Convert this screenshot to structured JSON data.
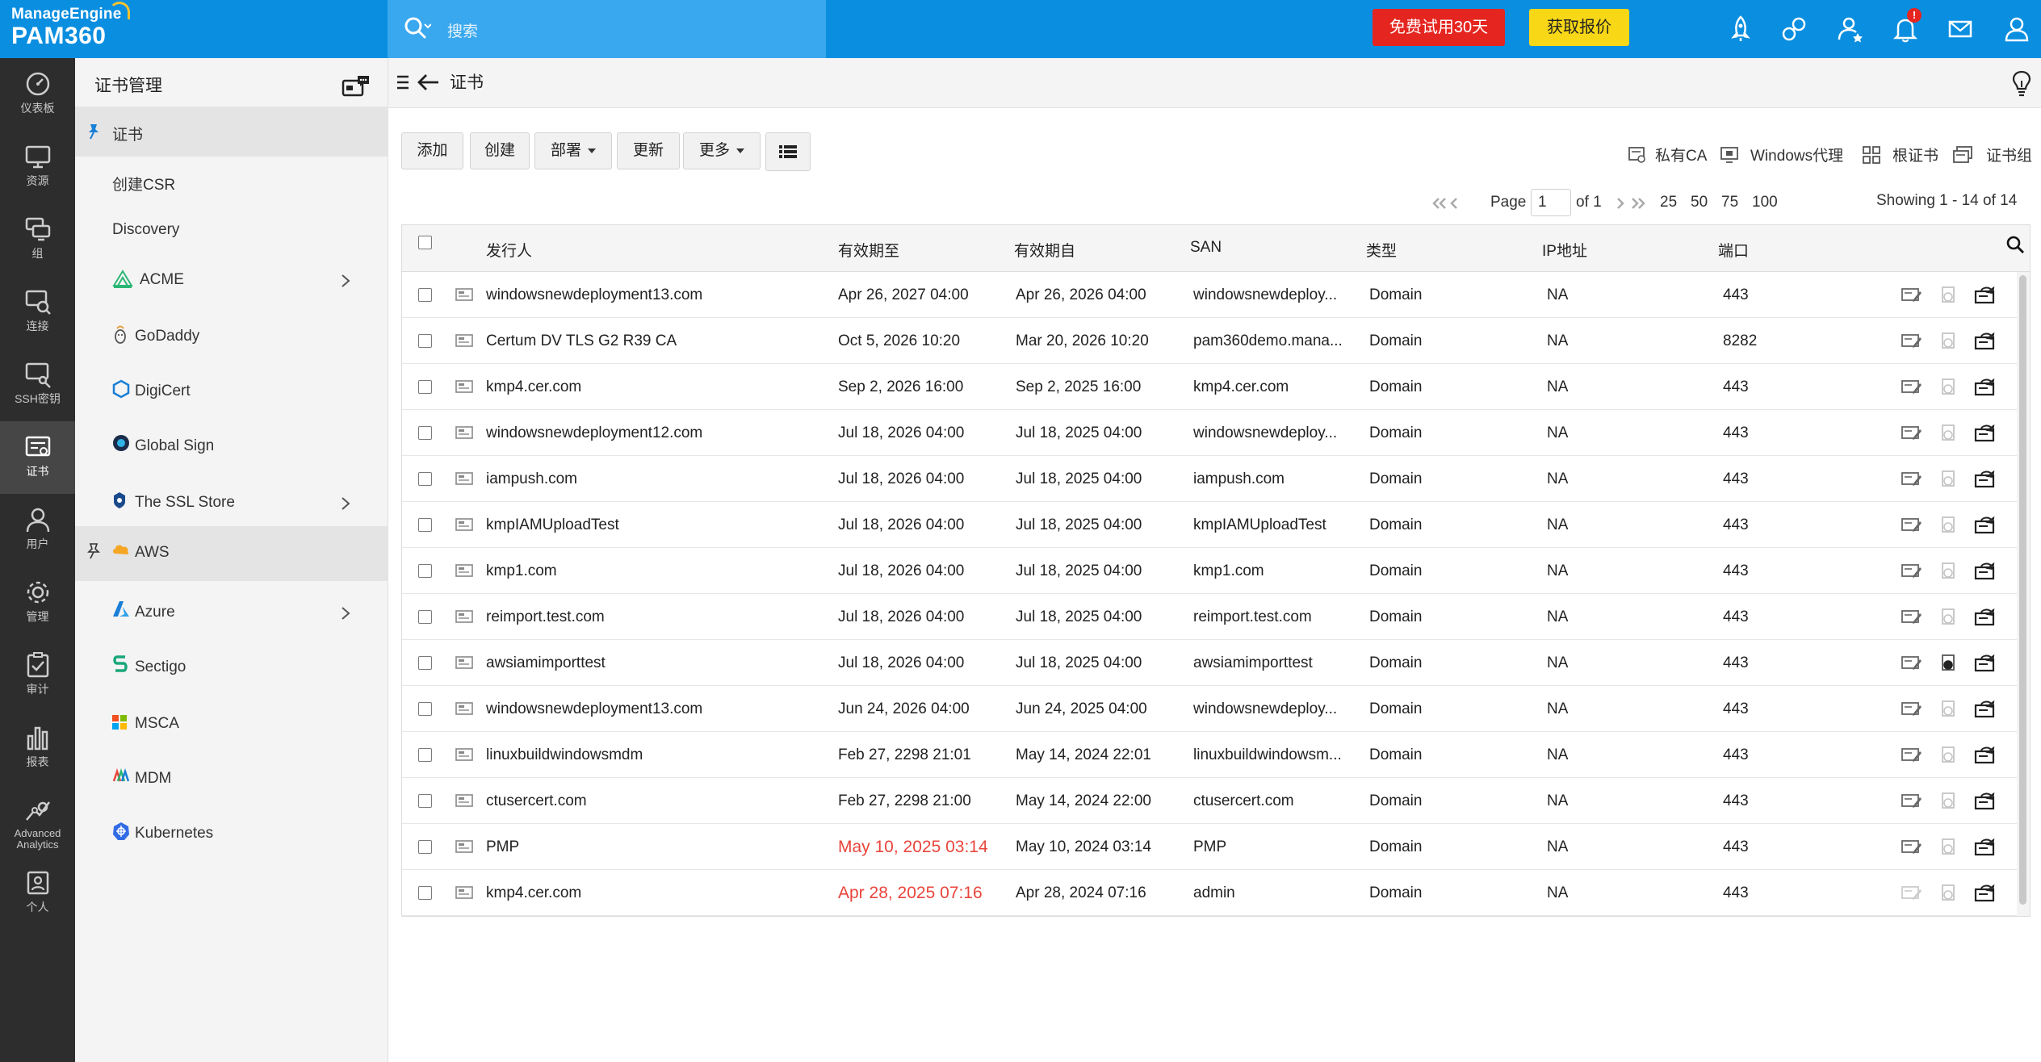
{
  "brand": {
    "company": "ManageEngine",
    "product": "PAM360"
  },
  "search": {
    "placeholder": "搜索"
  },
  "header_buttons": {
    "trial": "免费试用30天",
    "quote": "获取报价"
  },
  "top_icons": [
    "rocket-icon",
    "integration-icon",
    "user-star-icon",
    "bell-icon",
    "mail-icon",
    "user-icon"
  ],
  "notifications_badge": "!",
  "sidebar": [
    {
      "label": "仪表板",
      "icon": "dashboard-icon"
    },
    {
      "label": "资源",
      "icon": "monitor-icon"
    },
    {
      "label": "组",
      "icon": "groups-icon"
    },
    {
      "label": "连接",
      "icon": "connections-icon"
    },
    {
      "label": "SSH密钥",
      "icon": "ssh-key-icon"
    },
    {
      "label": "证书",
      "icon": "certificate-icon",
      "active": true
    },
    {
      "label": "用户",
      "icon": "user-icon"
    },
    {
      "label": "管理",
      "icon": "gear-icon"
    },
    {
      "label": "审计",
      "icon": "audit-icon"
    },
    {
      "label": "报表",
      "icon": "reports-icon"
    },
    {
      "label": "Advanced Analytics",
      "icon": "analytics-icon"
    },
    {
      "label": "个人",
      "icon": "personal-icon"
    }
  ],
  "subnav": {
    "title": "证书管理",
    "items": [
      {
        "label": "证书",
        "active": true,
        "pinned": true
      },
      {
        "label": "创建CSR"
      },
      {
        "label": "Discovery"
      },
      {
        "label": "ACME",
        "icon": "acme-icon",
        "has_children": true
      },
      {
        "label": "GoDaddy",
        "icon": "godaddy-icon"
      },
      {
        "label": "DigiCert",
        "icon": "digicert-icon"
      },
      {
        "label": "Global Sign",
        "icon": "globalsign-icon"
      },
      {
        "label": "The SSL Store",
        "icon": "sslstore-icon",
        "has_children": true
      },
      {
        "label": "AWS",
        "icon": "aws-icon",
        "hover": true
      },
      {
        "label": "Azure",
        "icon": "azure-icon",
        "has_children": true
      },
      {
        "label": "Sectigo",
        "icon": "sectigo-icon"
      },
      {
        "label": "MSCA",
        "icon": "msca-icon"
      },
      {
        "label": "MDM",
        "icon": "mdm-icon"
      },
      {
        "label": "Kubernetes",
        "icon": "kubernetes-icon"
      }
    ]
  },
  "page": {
    "title": "证书"
  },
  "toolbar": {
    "add": "添加",
    "create": "创建",
    "deploy": "部署",
    "update": "更新",
    "more": "更多",
    "right_links": [
      "私有CA",
      "Windows代理",
      "根证书",
      "证书组"
    ]
  },
  "pagination": {
    "page_label": "Page",
    "page_value": "1",
    "of_label": "of 1",
    "page_sizes": [
      "25",
      "50",
      "75",
      "100"
    ],
    "showing": "Showing 1 - 14 of 14"
  },
  "table": {
    "columns": [
      "发行人",
      "有效期至",
      "有效期自",
      "SAN",
      "类型",
      "IP地址",
      "端口"
    ],
    "rows": [
      {
        "issuer": "windowsnewdeployment13.com",
        "valid_to": "Apr 26, 2027 04:00",
        "valid_from": "Apr 26, 2026 04:00",
        "san": "windowsnewdeploy...",
        "type": "Domain",
        "ip": "NA",
        "port": "443"
      },
      {
        "issuer": "Certum DV TLS G2 R39 CA",
        "valid_to": "Oct 5, 2026 10:20",
        "valid_from": "Mar 20, 2026 10:20",
        "san": "pam360demo.mana...",
        "type": "Domain",
        "ip": "NA",
        "port": "8282"
      },
      {
        "issuer": "kmp4.cer.com",
        "valid_to": "Sep 2, 2026 16:00",
        "valid_from": "Sep 2, 2025 16:00",
        "san": "kmp4.cer.com",
        "type": "Domain",
        "ip": "NA",
        "port": "443"
      },
      {
        "issuer": "windowsnewdeployment12.com",
        "valid_to": "Jul 18, 2026 04:00",
        "valid_from": "Jul 18, 2025 04:00",
        "san": "windowsnewdeploy...",
        "type": "Domain",
        "ip": "NA",
        "port": "443"
      },
      {
        "issuer": "iampush.com",
        "valid_to": "Jul 18, 2026 04:00",
        "valid_from": "Jul 18, 2025 04:00",
        "san": "iampush.com",
        "type": "Domain",
        "ip": "NA",
        "port": "443"
      },
      {
        "issuer": "kmpIAMUploadTest",
        "valid_to": "Jul 18, 2026 04:00",
        "valid_from": "Jul 18, 2025 04:00",
        "san": "kmpIAMUploadTest",
        "type": "Domain",
        "ip": "NA",
        "port": "443"
      },
      {
        "issuer": "kmp1.com",
        "valid_to": "Jul 18, 2026 04:00",
        "valid_from": "Jul 18, 2025 04:00",
        "san": "kmp1.com",
        "type": "Domain",
        "ip": "NA",
        "port": "443"
      },
      {
        "issuer": "reimport.test.com",
        "valid_to": "Jul 18, 2026 04:00",
        "valid_from": "Jul 18, 2025 04:00",
        "san": "reimport.test.com",
        "type": "Domain",
        "ip": "NA",
        "port": "443"
      },
      {
        "issuer": "awsiamimporttest",
        "valid_to": "Jul 18, 2026 04:00",
        "valid_from": "Jul 18, 2025 04:00",
        "san": "awsiamimporttest",
        "type": "Domain",
        "ip": "NA",
        "port": "443"
      },
      {
        "issuer": "windowsnewdeployment13.com",
        "valid_to": "Jun 24, 2026 04:00",
        "valid_from": "Jun 24, 2025 04:00",
        "san": "windowsnewdeploy...",
        "type": "Domain",
        "ip": "NA",
        "port": "443"
      },
      {
        "issuer": "linuxbuildwindowsmdm",
        "valid_to": "Feb 27, 2298 21:01",
        "valid_from": "May 14, 2024 22:01",
        "san": "linuxbuildwindowsm...",
        "type": "Domain",
        "ip": "NA",
        "port": "443"
      },
      {
        "issuer": "ctusercert.com",
        "valid_to": "Feb 27, 2298 21:00",
        "valid_from": "May 14, 2024 22:00",
        "san": "ctusercert.com",
        "type": "Domain",
        "ip": "NA",
        "port": "443"
      },
      {
        "issuer": "PMP",
        "valid_to": "May 10, 2025 03:14",
        "valid_from": "May 10, 2024 03:14",
        "san": "PMP",
        "type": "Domain",
        "ip": "NA",
        "port": "443",
        "expired": true
      },
      {
        "issuer": "kmp4.cer.com",
        "valid_to": "Apr 28, 2025 07:16",
        "valid_from": "Apr 28, 2024 07:16",
        "san": "admin",
        "type": "Domain",
        "ip": "NA",
        "port": "443",
        "expired": true
      }
    ]
  },
  "colors": {
    "topbar": "#0a8ee0",
    "trial": "#e5251f",
    "quote": "#f7d716",
    "expired": "#e8453c",
    "sidebar": "#2d2d2d"
  }
}
